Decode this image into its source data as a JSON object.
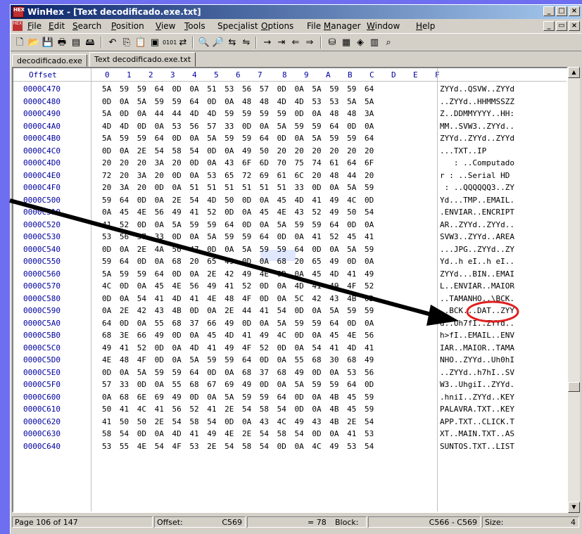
{
  "window": {
    "title": "WinHex - [Text decodificado.exe.txt]",
    "app_icon": "HEX"
  },
  "menu": [
    {
      "label": "File",
      "u": "F"
    },
    {
      "label": "Edit",
      "u": "E"
    },
    {
      "label": "Search",
      "u": "S"
    },
    {
      "label": "Position",
      "u": "P"
    },
    {
      "label": "View",
      "u": "V"
    },
    {
      "label": "Tools",
      "u": "T"
    },
    {
      "label": "Specialist",
      "u": "i"
    },
    {
      "label": "Options",
      "u": "O"
    },
    {
      "label": "File Manager",
      "u": "M"
    },
    {
      "label": "Window",
      "u": "W"
    },
    {
      "label": "Help",
      "u": "H"
    }
  ],
  "tabs": [
    "decodificado.exe",
    "Text decodificado.exe.txt"
  ],
  "hex": {
    "header_offset": "Offset",
    "columns": [
      "0",
      "1",
      "2",
      "3",
      "4",
      "5",
      "6",
      "7",
      "8",
      "9",
      "A",
      "B",
      "C",
      "D",
      "E",
      "F"
    ],
    "rows": [
      {
        "off": "0000C470",
        "hex": "5A 59 59 64 0D 0A 51 53 56 57 0D 0A 5A 59 59 64",
        "ascii": "ZYYd..QSVW..ZYYd"
      },
      {
        "off": "0000C480",
        "hex": "0D 0A 5A 59 59 64 0D 0A 48 48 4D 4D 53 53 5A 5A",
        "ascii": "..ZYYd..HHMMSSZZ"
      },
      {
        "off": "0000C490",
        "hex": "5A 0D 0A 44 44 4D 4D 59 59 59 59 0D 0A 48 48 3A",
        "ascii": "Z..DDMMYYYY..HH:"
      },
      {
        "off": "0000C4A0",
        "hex": "4D 4D 0D 0A 53 56 57 33 0D 0A 5A 59 59 64 0D 0A",
        "ascii": "MM..SVW3..ZYYd.."
      },
      {
        "off": "0000C4B0",
        "hex": "5A 59 59 64 0D 0A 5A 59 59 64 0D 0A 5A 59 59 64",
        "ascii": "ZYYd..ZYYd..ZYYd"
      },
      {
        "off": "0000C4C0",
        "hex": "0D 0A 2E 54 58 54 0D 0A 49 50 20 20 20 20 20 20",
        "ascii": "...TXT..IP"
      },
      {
        "off": "0000C4D0",
        "hex": "20 20 20 3A 20 0D 0A 43 6F 6D 70 75 74 61 64 6F",
        "ascii": "   : ..Computado"
      },
      {
        "off": "0000C4E0",
        "hex": "72 20 3A 20 0D 0A 53 65 72 69 61 6C 20 48 44 20",
        "ascii": "r : ..Serial HD"
      },
      {
        "off": "0000C4F0",
        "hex": "20 3A 20 0D 0A 51 51 51 51 51 51 33 0D 0A 5A 59",
        "ascii": " : ..QQQQQQ3..ZY"
      },
      {
        "off": "0000C500",
        "hex": "59 64 0D 0A 2E 54 4D 50 0D 0A 45 4D 41 49 4C 0D",
        "ascii": "Yd...TMP..EMAIL."
      },
      {
        "off": "0000C510",
        "hex": "0A 45 4E 56 49 41 52 0D 0A 45 4E 43 52 49 50 54",
        "ascii": ".ENVIAR..ENCRIPT"
      },
      {
        "off": "0000C520",
        "hex": "41 52 0D 0A 5A 59 59 64 0D 0A 5A 59 59 64 0D 0A",
        "ascii": "AR..ZYYd..ZYYd.."
      },
      {
        "off": "0000C530",
        "hex": "53 56 57 33 0D 0A 5A 59 59 64 0D 0A 41 52 45 41",
        "ascii": "SVW3..ZYYd..AREA"
      },
      {
        "off": "0000C540",
        "hex": "0D 0A 2E 4A 50 47 0D 0A 5A 59 59 64 0D 0A 5A 59",
        "ascii": "...JPG..ZYYd..ZY"
      },
      {
        "off": "0000C550",
        "hex": "59 64 0D 0A 68 20 65 49 0D 0A 68 20 65 49 0D 0A",
        "ascii": "Yd..h eI..h eI.."
      },
      {
        "off": "0000C560",
        "hex": "5A 59 59 64 0D 0A 2E 42 49 4E 0D 0A 45 4D 41 49",
        "ascii": "ZYYd...BIN..EMAI"
      },
      {
        "off": "0000C570",
        "hex": "4C 0D 0A 45 4E 56 49 41 52 0D 0A 4D 41 49 4F 52",
        "ascii": "L..ENVIAR..MAIOR"
      },
      {
        "off": "0000C580",
        "hex": "0D 0A 54 41 4D 41 4E 48 4F 0D 0A 5C 42 43 4B 0D",
        "ascii": "..TAMANHO..\\BCK."
      },
      {
        "off": "0000C590",
        "hex": "0A 2E 42 43 4B 0D 0A 2E 44 41 54 0D 0A 5A 59 59",
        "ascii": "..BCK...DAT..ZYY"
      },
      {
        "off": "0000C5A0",
        "hex": "64 0D 0A 55 68 37 66 49 0D 0A 5A 59 59 64 0D 0A",
        "ascii": "d..Uh7fI..ZYYd.."
      },
      {
        "off": "0000C5B0",
        "hex": "68 3E 66 49 0D 0A 45 4D 41 49 4C 0D 0A 45 4E 56",
        "ascii": "h>fI..EMAIL..ENV"
      },
      {
        "off": "0000C5C0",
        "hex": "49 41 52 0D 0A 4D 41 49 4F 52 0D 0A 54 41 4D 41",
        "ascii": "IAR..MAIOR..TAMA"
      },
      {
        "off": "0000C5D0",
        "hex": "4E 48 4F 0D 0A 5A 59 59 64 0D 0A 55 68 30 68 49",
        "ascii": "NHO..ZYYd..Uh0hI"
      },
      {
        "off": "0000C5E0",
        "hex": "0D 0A 5A 59 59 64 0D 0A 68 37 68 49 0D 0A 53 56",
        "ascii": "..ZYYd..h7hI..SV"
      },
      {
        "off": "0000C5F0",
        "hex": "57 33 0D 0A 55 68 67 69 49 0D 0A 5A 59 59 64 0D",
        "ascii": "W3..UhgiI..ZYYd."
      },
      {
        "off": "0000C600",
        "hex": "0A 68 6E 69 49 0D 0A 5A 59 59 64 0D 0A 4B 45 59",
        "ascii": ".hniI..ZYYd..KEY"
      },
      {
        "off": "0000C610",
        "hex": "50 41 4C 41 56 52 41 2E 54 58 54 0D 0A 4B 45 59",
        "ascii": "PALAVRA.TXT..KEY"
      },
      {
        "off": "0000C620",
        "hex": "41 50 50 2E 54 58 54 0D 0A 43 4C 49 43 4B 2E 54",
        "ascii": "APP.TXT..CLICK.T"
      },
      {
        "off": "0000C630",
        "hex": "58 54 0D 0A 4D 41 49 4E 2E 54 58 54 0D 0A 41 53",
        "ascii": "XT..MAIN.TXT..AS"
      },
      {
        "off": "0000C640",
        "hex": "53 55 4E 54 4F 53 2E 54 58 54 0D 0A 4C 49 53 54",
        "ascii": "SUNTOS.TXT..LIST"
      }
    ]
  },
  "status": {
    "page": "Page 106 of 147",
    "offset_label": "Offset:",
    "offset_value": "C569",
    "eq_value": "= 78",
    "block_label": "Block:",
    "block_value": "C566 - C569",
    "size_label": "Size:",
    "size_value": "4"
  },
  "colors": {
    "annotation_arrow": "#000000",
    "annotation_circle": "#e02020",
    "background": "#6e6ef0"
  }
}
